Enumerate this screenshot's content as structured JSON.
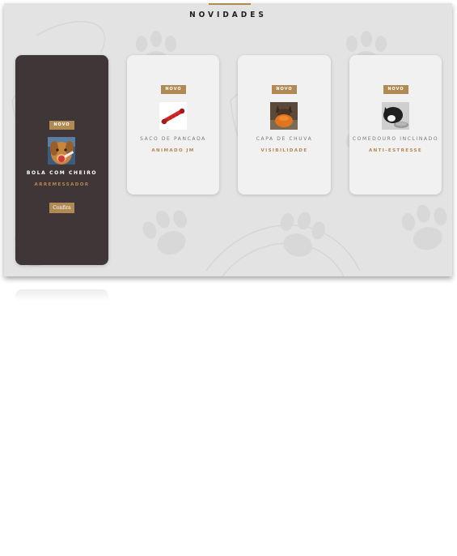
{
  "section": {
    "title": "NOVIDADES",
    "accent_color": "#b08a52",
    "background_color": "#e4e3e3"
  },
  "cards": [
    {
      "badge": "NOVO",
      "name": "BOLA COM CHEIRO",
      "subtitle": "ARREMESSADOR",
      "button_label": "Confira",
      "image": "dog-with-ball-photo",
      "highlighted": true
    },
    {
      "badge": "NOVO",
      "name": "SACO DE PANCADA",
      "subtitle": "ANIMADO JM",
      "image": "red-rope-toy-photo",
      "highlighted": false
    },
    {
      "badge": "NOVO",
      "name": "CAPA DE CHUVA",
      "subtitle": "VISIBILIDADE",
      "image": "dog-in-orange-raincoat-photo",
      "highlighted": false
    },
    {
      "badge": "NOVO",
      "name": "COMEDOURO INCLINADO",
      "subtitle": "ANTI-ESTRESSE",
      "image": "cat-at-feeder-photo",
      "highlighted": false
    }
  ]
}
